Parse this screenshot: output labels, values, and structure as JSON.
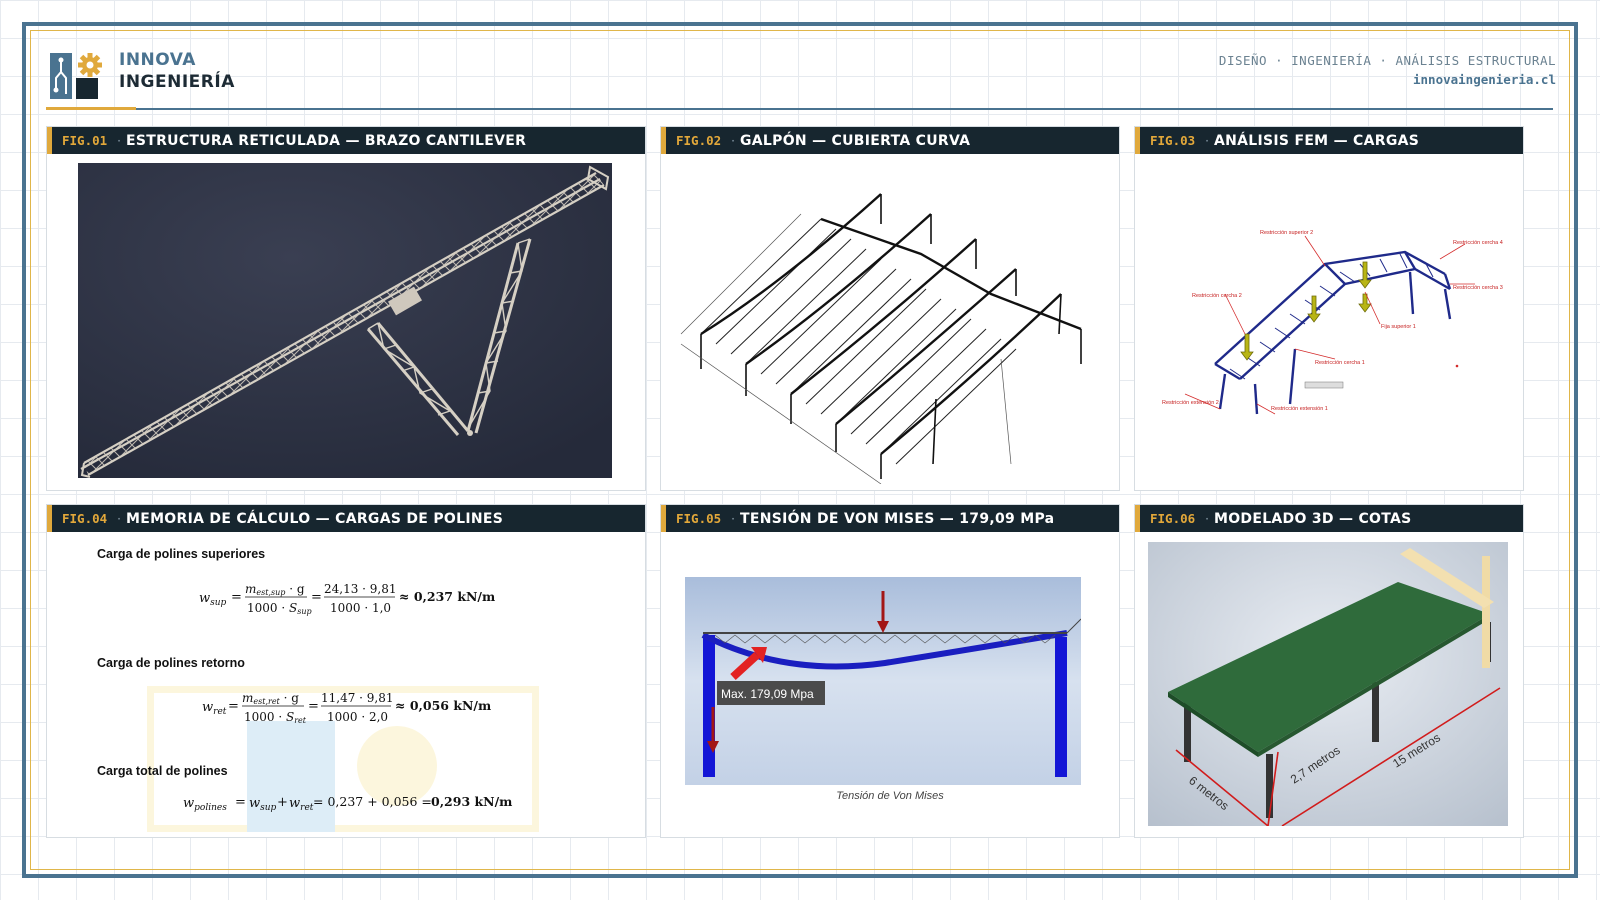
{
  "header": {
    "brand_line1": "INNOVA",
    "brand_line2": "INGENIERÍA",
    "tagline": "DISEÑO · INGENIERÍA · ANÁLISIS ESTRUCTURAL",
    "website": "innovaingenieria.cl"
  },
  "colors": {
    "primary": "#4a7390",
    "accent": "#e0a93c",
    "title_bar": "#17262f",
    "render_bg": "#2c3142"
  },
  "panels": [
    {
      "tag": "FIG.01",
      "title": "ESTRUCTURA RETICULADA — BRAZO CANTILEVER"
    },
    {
      "tag": "FIG.02",
      "title": "GALPÓN — CUBIERTA CURVA"
    },
    {
      "tag": "FIG.03",
      "title": "ANÁLISIS FEM — CARGAS"
    },
    {
      "tag": "FIG.04",
      "title": "MEMORIA DE CÁLCULO — CARGAS DE POLINES"
    },
    {
      "tag": "FIG.05",
      "title": "TENSIÓN DE VON MISES — 179,09 MPa"
    },
    {
      "tag": "FIG.06",
      "title": "MODELADO 3D — COTAS"
    }
  ],
  "fem_labels": {
    "r_sup2": "Restricción superior 2",
    "r_cercha4": "Restricción cercha 4",
    "r_cercha3": "Restricción cercha 3",
    "r_cercha2": "Restricción cercha 2",
    "fija_sup1": "Fija superior 1",
    "r_cercha1": "Restricción cercha 1",
    "r_ext2": "Restricción extensión 2",
    "r_ext1": "Restricción extensión 1"
  },
  "calc": {
    "h1": "Carga de polines superiores",
    "h2": "Carga de polines retorno",
    "h3": "Carga total de polines",
    "eq1_result": "≈ 0,237 kN/m",
    "eq2_result": "≈ 0,056 kN/m",
    "eq1_num": "24,13 · 9,81",
    "eq1_den": "1000 · 1,0",
    "eq2_num": "11,47 · 9,81",
    "eq2_den": "1000 · 2,0",
    "eq3_vals": "= 0,237 + 0,056 =",
    "eq3_result": "0,293 kN/m"
  },
  "vonmises": {
    "max_label": "Max. 179,09 Mpa",
    "caption": "Tensión de Von Mises"
  },
  "model3d": {
    "dim1": "6 metros",
    "dim2": "2,7 metros",
    "dim3": "15 metros"
  }
}
